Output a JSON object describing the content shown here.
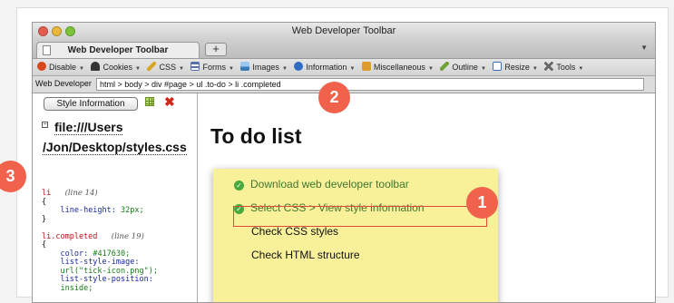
{
  "window": {
    "title": "Web Developer Toolbar",
    "tab_label": "Web Developer Toolbar",
    "new_tab": "+"
  },
  "toolbar": {
    "items": [
      {
        "label": "Disable",
        "icon": "disable-icon",
        "color": "#d9471f"
      },
      {
        "label": "Cookies",
        "icon": "person-icon",
        "color": "#333333"
      },
      {
        "label": "CSS",
        "icon": "pencil-icon",
        "color": "#d9a520"
      },
      {
        "label": "Forms",
        "icon": "form-icon",
        "color": "#5670a8"
      },
      {
        "label": "Images",
        "icon": "image-icon",
        "color": "#3a7ab8"
      },
      {
        "label": "Information",
        "icon": "info-icon",
        "color": "#2f6dc4"
      },
      {
        "label": "Miscellaneous",
        "icon": "misc-icon",
        "color": "#e09b2d"
      },
      {
        "label": "Outline",
        "icon": "outline-pencil-icon",
        "color": "#6fa33a"
      },
      {
        "label": "Resize",
        "icon": "resize-icon",
        "color": "#3a6fb0"
      },
      {
        "label": "Tools",
        "icon": "tools-icon",
        "color": "#666666"
      }
    ]
  },
  "breadcrumb": {
    "label": "Web Developer",
    "path": "html > body > div #page > ul .to-do > li .completed"
  },
  "style_panel": {
    "button_label": "Style Information",
    "file_url_line1": "file:///Users",
    "file_url_line2": "/Jon/Desktop/styles.css",
    "rule1": {
      "selector": "li",
      "comment": "(line 14)",
      "open": "{",
      "decls": [
        {
          "prop": "line-height:",
          "value": "32px;"
        }
      ],
      "close": "}"
    },
    "rule2": {
      "selector": "li.completed",
      "comment": "(line 19)",
      "open": "{",
      "decls": [
        {
          "prop": "color:",
          "value": "#417630;"
        },
        {
          "prop": "list-style-image:",
          "value": ""
        },
        {
          "prop": "",
          "value": "url(\"tick-icon.png\");"
        },
        {
          "prop": "list-style-position:",
          "value": ""
        },
        {
          "prop": "",
          "value": "inside;"
        }
      ]
    }
  },
  "content": {
    "heading": "To do list",
    "items": [
      {
        "text": "Download web developer toolbar",
        "completed": true
      },
      {
        "text": "Select CSS > View style information",
        "completed": true
      },
      {
        "text": "Check CSS styles",
        "completed": false
      },
      {
        "text": "Check HTML structure",
        "completed": false
      }
    ]
  },
  "callouts": [
    "1",
    "2",
    "3"
  ],
  "colors": {
    "callout": "#f0624c",
    "todo_background": "#f8f19a",
    "completed_text": "#417630",
    "highlight_border": "#e04a3a"
  }
}
